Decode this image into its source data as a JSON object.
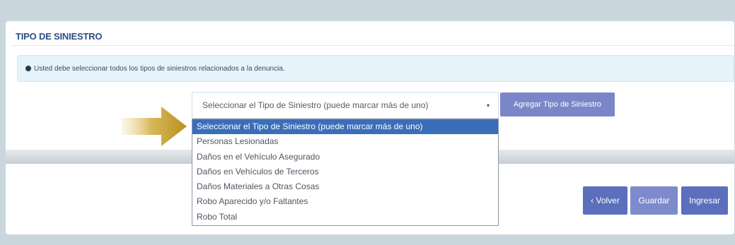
{
  "section": {
    "title": "TIPO DE SINIESTRO"
  },
  "info": {
    "message": "Usted debe seleccionar todos los tipos de siniestros relacionados a la denuncia.",
    "icon": "info-circle-icon"
  },
  "select": {
    "selected_value": "Seleccionar el Tipo de Siniestro (puede marcar más de uno)",
    "caret": "▾",
    "options": [
      "Seleccionar el Tipo de Siniestro (puede marcar más de uno)",
      "Personas Lesionadas",
      "Daños en el Vehículo Asegurado",
      "Daños en Vehículos de Terceros",
      "Daños Materiales a Otras Cosas",
      "Robo Aparecido y/o Faltantes",
      "Robo Total"
    ],
    "highlighted_index": 0
  },
  "add_button": {
    "label": "Agregar Tipo de Siniestro"
  },
  "actions": {
    "back_label": "‹ Volver",
    "save_label": "Guardar",
    "submit_label": "Ingresar"
  },
  "colors": {
    "title": "#2d4d8a",
    "info_bg": "#e6f3fa",
    "option_highlight": "#3a6eb8",
    "button_primary": "#5b6fbc",
    "button_secondary": "#7d8bcc",
    "arrow_gold": "#c9a227"
  }
}
